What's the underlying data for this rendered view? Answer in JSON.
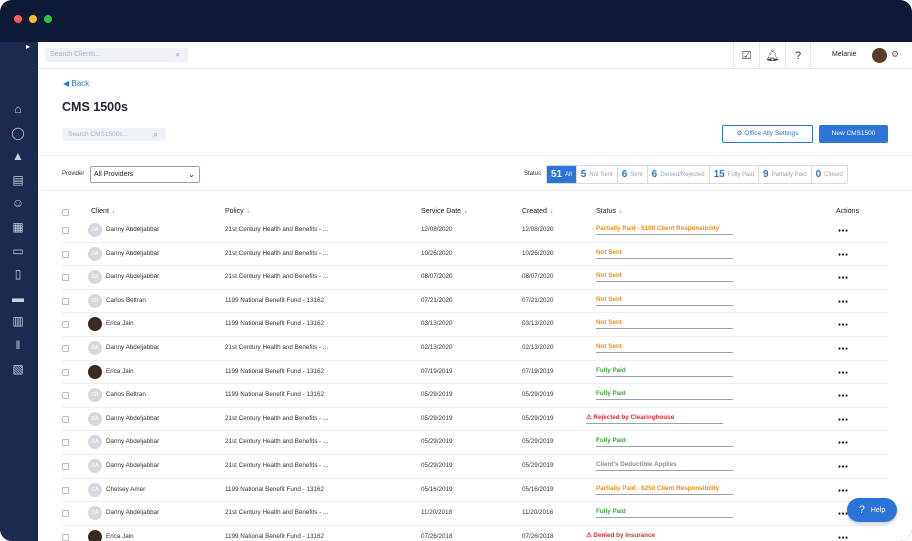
{
  "window": {
    "dot_colors": [
      "#ff5f57",
      "#febc2e",
      "#28c840"
    ]
  },
  "sidebar": {
    "toggle_icon": "chevron-right-icon",
    "items": [
      {
        "icon": "home-icon",
        "glyph": "⌂"
      },
      {
        "icon": "chat-icon",
        "glyph": "◯"
      },
      {
        "icon": "graduation-cap-icon",
        "glyph": "▲"
      },
      {
        "icon": "building-icon",
        "glyph": "▤"
      },
      {
        "icon": "users-icon",
        "glyph": "☺"
      },
      {
        "icon": "calendar-icon",
        "glyph": "▦"
      },
      {
        "icon": "box-icon",
        "glyph": "▭"
      },
      {
        "icon": "clipboard-icon",
        "glyph": "▯"
      },
      {
        "icon": "card-icon",
        "glyph": "▬"
      },
      {
        "icon": "report-icon",
        "glyph": "▥"
      },
      {
        "icon": "columns-icon",
        "glyph": "‖"
      },
      {
        "icon": "document-icon",
        "glyph": "▧"
      }
    ]
  },
  "topbar": {
    "search_placeholder": "Search Clients...",
    "user_name": "Melanie"
  },
  "page": {
    "back_label": "Back",
    "title": "CMS 1500s",
    "search_placeholder": "Search CMS1500s...",
    "office_ally_label": "Office Ally Settings",
    "new_label": "New CMS1500"
  },
  "filters": {
    "provider_label": "Provider",
    "provider_value": "All Providers",
    "status_label": "Status",
    "tabs": [
      {
        "count": "51",
        "label": "All",
        "active": true
      },
      {
        "count": "5",
        "label": "Not Sent"
      },
      {
        "count": "6",
        "label": "Sent"
      },
      {
        "count": "6",
        "label": "Denied/Rejected"
      },
      {
        "count": "15",
        "label": "Fully Paid"
      },
      {
        "count": "9",
        "label": "Partially Paid"
      },
      {
        "count": "0",
        "label": "Closed"
      }
    ]
  },
  "table": {
    "headers": {
      "client": "Client",
      "policy": "Policy",
      "service_date": "Service Date",
      "created": "Created",
      "status": "Status",
      "actions": "Actions"
    },
    "rows": [
      {
        "initials": "DA",
        "client": "Danny Abdeljabbar",
        "policy": "21st Century Health and Benefits - ...",
        "service_date": "12/08/2020",
        "created": "12/08/2020",
        "status": "Partially Paid - $100 Client Responsibility",
        "tone": "orange"
      },
      {
        "initials": "DA",
        "client": "Danny Abdeljabbar",
        "policy": "21st Century Health and Benefits - ...",
        "service_date": "10/26/2020",
        "created": "10/26/2020",
        "status": "Not Sent",
        "tone": "orange"
      },
      {
        "initials": "DA",
        "client": "Danny Abdeljabbar",
        "policy": "21st Century Health and Benefits - ...",
        "service_date": "08/07/2020",
        "created": "08/07/2020",
        "status": "Not Sent",
        "tone": "orange"
      },
      {
        "initials": "CB",
        "client": "Carlos Beltran",
        "policy": "1199 National Benefit Fund - 13162",
        "service_date": "07/21/2020",
        "created": "07/21/2020",
        "status": "Not Sent",
        "tone": "orange"
      },
      {
        "initials": "",
        "photo": true,
        "client": "Erica Jain",
        "policy": "1199 National Benefit Fund - 13162",
        "service_date": "03/13/2020",
        "created": "03/13/2020",
        "status": "Not Sent",
        "tone": "orange"
      },
      {
        "initials": "DA",
        "client": "Danny Abdeljabbar",
        "policy": "21st Century Health and Benefits - ...",
        "service_date": "02/13/2020",
        "created": "02/13/2020",
        "status": "Not Sent",
        "tone": "orange"
      },
      {
        "initials": "",
        "photo": true,
        "client": "Erica Jain",
        "policy": "1199 National Benefit Fund - 13162",
        "service_date": "07/19/2019",
        "created": "07/19/2019",
        "status": "Fully Paid",
        "tone": "green"
      },
      {
        "initials": "CB",
        "client": "Carlos Beltran",
        "policy": "1199 National Benefit Fund - 13162",
        "service_date": "05/29/2019",
        "created": "05/29/2019",
        "status": "Fully Paid",
        "tone": "green"
      },
      {
        "initials": "DA",
        "client": "Danny Abdeljabbar",
        "policy": "21st Century Health and Benefits - ...",
        "service_date": "05/29/2019",
        "created": "05/29/2019",
        "status": "Rejected by Clearinghouse",
        "tone": "red",
        "warn": true
      },
      {
        "initials": "DA",
        "client": "Danny Abdeljabbar",
        "policy": "21st Century Health and Benefits - ...",
        "service_date": "05/29/2019",
        "created": "05/29/2019",
        "status": "Fully Paid",
        "tone": "green"
      },
      {
        "initials": "DA",
        "client": "Danny Abdeljabbar",
        "policy": "21st Century Health and Benefits - ...",
        "service_date": "05/29/2019",
        "created": "05/29/2019",
        "status": "Client's Deductible Applies",
        "tone": "gray"
      },
      {
        "initials": "CA",
        "client": "Chelsey Amer",
        "policy": "1199 National Benefit Fund - 13162",
        "service_date": "05/16/2019",
        "created": "05/16/2019",
        "status": "Partially Paid - $250 Client Responsibility",
        "tone": "orange"
      },
      {
        "initials": "DA",
        "client": "Danny Abdeljabbar",
        "policy": "21st Century Health and Benefits - ...",
        "service_date": "11/20/2018",
        "created": "11/20/2018",
        "status": "Fully Paid",
        "tone": "green"
      },
      {
        "initials": "",
        "photo": true,
        "client": "Erica Jain",
        "policy": "1199 National Benefit Fund - 13162",
        "service_date": "07/26/2018",
        "created": "07/26/2018",
        "status": "Denied by Insurance",
        "tone": "red",
        "warn": true
      }
    ]
  },
  "help": {
    "label": "Help"
  }
}
